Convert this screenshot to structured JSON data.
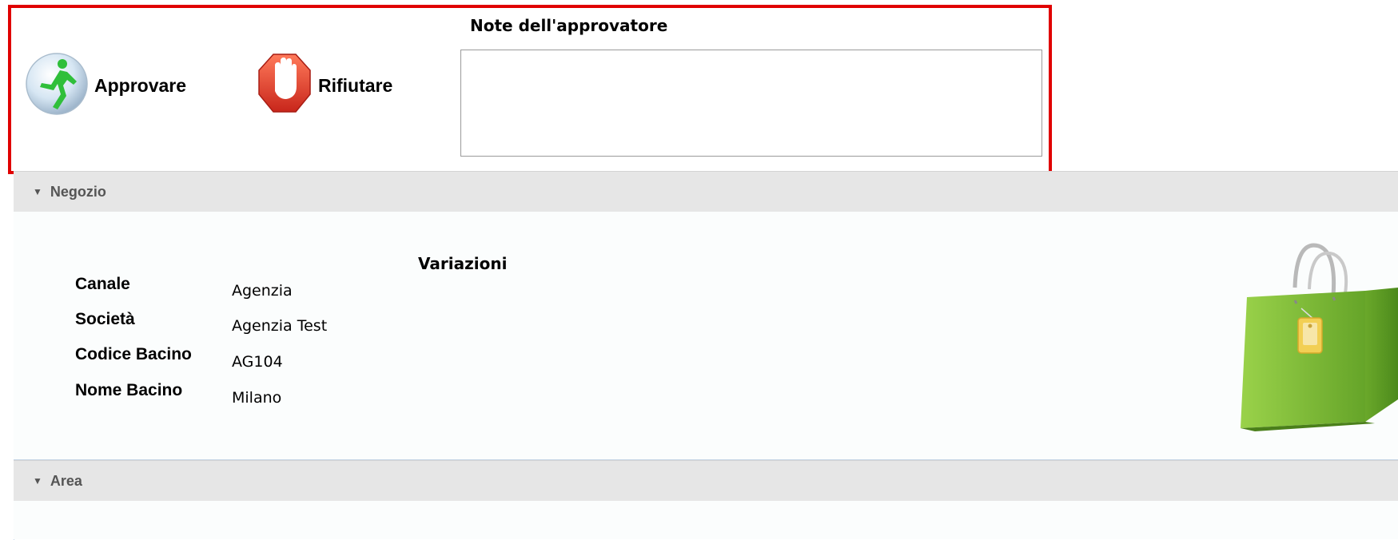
{
  "actions": {
    "approve_label": "Approvare",
    "reject_label": "Rifiutare",
    "approve_icon": "running-man-icon",
    "reject_icon": "stop-hand-icon"
  },
  "notes": {
    "title": "Note dell'approvatore",
    "value": ""
  },
  "panels": {
    "negozio": {
      "title": "Negozio",
      "section_title": "Variazioni",
      "fields": [
        {
          "label": "Canale",
          "value": "Agenzia"
        },
        {
          "label": "Società",
          "value": "Agenzia Test"
        },
        {
          "label": "Codice Bacino",
          "value": "AG104"
        },
        {
          "label": "Nome Bacino",
          "value": "Milano"
        }
      ],
      "icon": "shopping-bag-icon"
    },
    "area": {
      "title": "Area"
    }
  },
  "colors": {
    "highlight": "#e00000",
    "header_bg": "#e6e6e6",
    "approve_green": "#2fbf3a",
    "reject_red": "#e8402a",
    "bag_green": "#7bbf2e"
  }
}
